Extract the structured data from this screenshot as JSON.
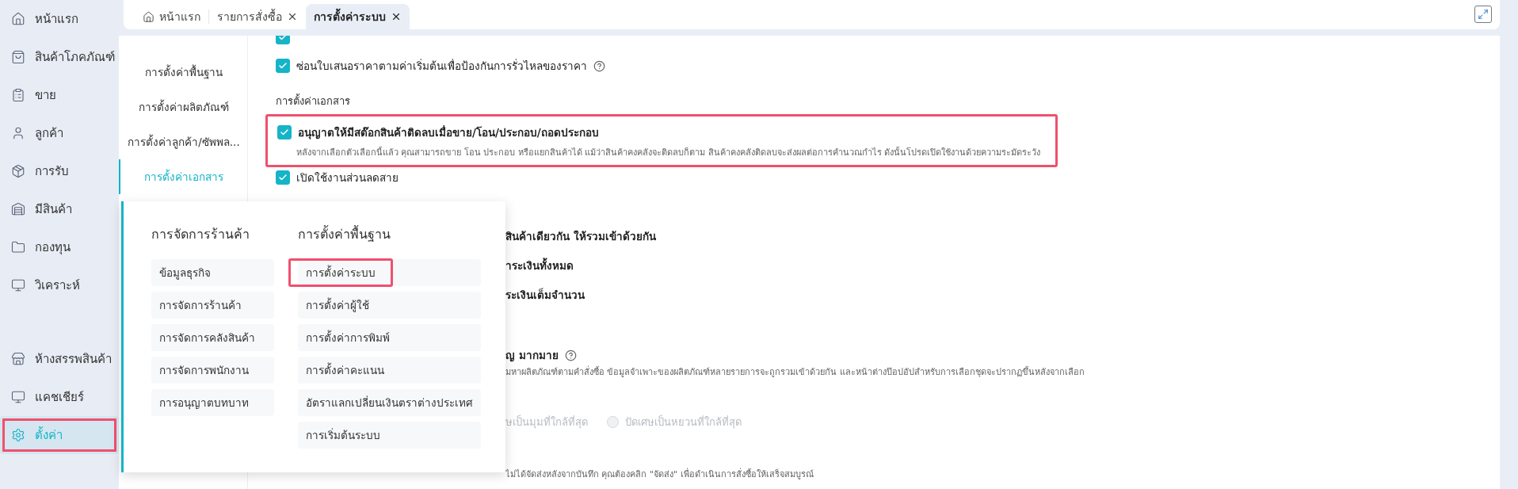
{
  "sidebar": {
    "items": [
      {
        "label": "หน้าแรก",
        "selected": false,
        "highlighted": false
      },
      {
        "label": "สินค้าโภคภัณฑ์",
        "selected": false,
        "highlighted": false
      },
      {
        "label": "ขาย",
        "selected": false,
        "highlighted": false
      },
      {
        "label": "ลูกค้า",
        "selected": false,
        "highlighted": false
      },
      {
        "label": "การรับ",
        "selected": false,
        "highlighted": false
      },
      {
        "label": "มีสินค้า",
        "selected": false,
        "highlighted": false
      },
      {
        "label": "กองทุน",
        "selected": false,
        "highlighted": false
      },
      {
        "label": "วิเคราะห์",
        "selected": false,
        "highlighted": false
      }
    ],
    "bottom_items": [
      {
        "label": "ห้างสรรพสินค้า",
        "selected": false,
        "highlighted": false
      },
      {
        "label": "แคชเชียร์",
        "selected": false,
        "highlighted": false
      },
      {
        "label": "ตั้งค่า",
        "selected": true,
        "highlighted": true
      }
    ]
  },
  "tabs": [
    {
      "label": "หน้าแรก",
      "selected": false,
      "closable": false
    },
    {
      "label": "รายการสั่งซื้อ",
      "selected": false,
      "closable": true
    },
    {
      "label": "การตั้งค่าระบบ",
      "selected": true,
      "closable": true
    }
  ],
  "settings_nav": [
    {
      "label": "การตั้งค่าพื้นฐาน",
      "selected": false
    },
    {
      "label": "การตั้งค่าผลิตภัณฑ์",
      "selected": false
    },
    {
      "label": "การตั้งค่าลูกค้า/ซัพพล...",
      "selected": false
    },
    {
      "label": "การตั้งค่าเอกสาร",
      "selected": true
    }
  ],
  "content": {
    "rows": [
      {
        "kind": "cut",
        "checked": true
      },
      {
        "kind": "checkbox",
        "checked": true,
        "label": "ซ่อนใบเสนอราคาตามค่าเริ่มต้นเพื่อป้องกันการรั่วไหลของราคา",
        "help": true
      },
      {
        "kind": "heading",
        "label": "การตั้งค่าเอกสาร"
      },
      {
        "kind": "checkbox",
        "checked": true,
        "highlighted": true,
        "label": "อนุญาตให้มีสต๊อกสินค้าติดลบเมื่อขาย/โอน/ประกอบ/ถอดประกอบ",
        "description": "หลังจากเลือกตัวเลือกนี้แล้ว คุณสามารถขาย โอน ประกอบ หรือแยกสินค้าได้ แม้ว่าสินค้าคงคลังจะติดลบก็ตาม สินค้าคงคลังติดลบจะส่งผลต่อการคำนวณกำไร ดังนั้นโปรดเปิดใช้งานด้วยความระมัดระวัง"
      },
      {
        "kind": "checkbox",
        "checked": true,
        "label": "เปิดใช้งานส่วนลดสาย"
      },
      {
        "kind": "partial",
        "label": "สินค้าเดียวกัน ให้รวมเข้าด้วยกัน"
      },
      {
        "kind": "partial",
        "label": "าระเงินทั้งหมด"
      },
      {
        "kind": "partial",
        "label": "ระเงินเต็มจำนวน"
      },
      {
        "kind": "partial",
        "label": "ญ มากมาย",
        "help": true,
        "description": "มหาผลิตภัณฑ์ตามคำสั่งซื้อ ข้อมูลจำเพาะของผลิตภัณฑ์หลายรายการจะถูกรวมเข้าด้วยกัน และหน้าต่างป๊อปอัปสำหรับการเลือกชุดจะปรากฏขึ้นหลังจากเลือก"
      },
      {
        "kind": "radios",
        "disabled": true,
        "lead": "ษเป็นมุมที่ใกล้ที่สุด",
        "options": [
          {
            "label": "ปัดเศษเป็นหยวนที่ใกล้ที่สุด",
            "selected": false
          }
        ]
      },
      {
        "kind": "note",
        "label": "ไม่ได้จัดส่งหลังจากบันทึก คุณต้องคลิก \"จัดส่ง\" เพื่อดำเนินการสั่งซื้อให้เสร็จสมบูรณ์"
      }
    ]
  },
  "popup": {
    "columns": [
      {
        "title": "การจัดการร้านค้า",
        "items": [
          {
            "label": "ข้อมูลธุรกิจ",
            "highlighted": false
          },
          {
            "label": "การจัดการร้านค้า",
            "highlighted": false
          },
          {
            "label": "การจัดการคลังสินค้า",
            "highlighted": false
          },
          {
            "label": "การจัดการพนักงาน",
            "highlighted": false
          },
          {
            "label": "การอนุญาตบทบาท",
            "highlighted": false
          }
        ]
      },
      {
        "title": "การตั้งค่าพื้นฐาน",
        "items": [
          {
            "label": "การตั้งค่าระบบ",
            "highlighted": true
          },
          {
            "label": "การตั้งค่าผู้ใช้",
            "highlighted": false
          },
          {
            "label": "การตั้งค่าการพิมพ์",
            "highlighted": false
          },
          {
            "label": "การตั้งค่าคะแนน",
            "highlighted": false
          },
          {
            "label": "อัตราแลกเปลี่ยนเงินตราต่างประเทศ",
            "highlighted": false
          },
          {
            "label": "การเริ่มต้นระบบ",
            "highlighted": false
          }
        ]
      }
    ]
  }
}
